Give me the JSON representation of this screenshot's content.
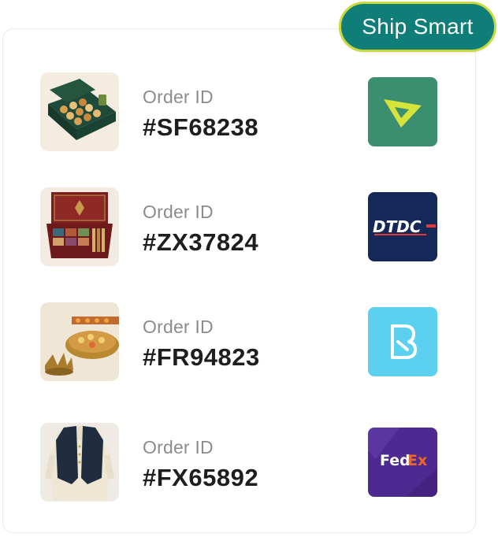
{
  "badge": {
    "label": "Ship Smart",
    "color": "#0f7d78",
    "border_color": "#c9d83a"
  },
  "orders": [
    {
      "label": "Order ID",
      "id": "#SF68238",
      "thumbnail": "gift-box-of-sweets-image",
      "carrier": "shiprocket-style-logo",
      "carrier_color": "#3c8f6e"
    },
    {
      "label": "Order ID",
      "id": "#ZX37824",
      "thumbnail": "makeup-kit-box-image",
      "carrier": "dtdc-logo",
      "carrier_text": "DTDC",
      "carrier_color": "#14285a"
    },
    {
      "label": "Order ID",
      "id": "#FR94823",
      "thumbnail": "diya-thali-image",
      "carrier": "blue-b-logo",
      "carrier_color": "#5bd0ef"
    },
    {
      "label": "Order ID",
      "id": "#FX65892",
      "thumbnail": "nehru-jacket-kurta-image",
      "carrier": "fedex-logo",
      "carrier_text_a": "Fed",
      "carrier_text_b": "Ex",
      "carrier_color": "#4d2a91"
    }
  ]
}
